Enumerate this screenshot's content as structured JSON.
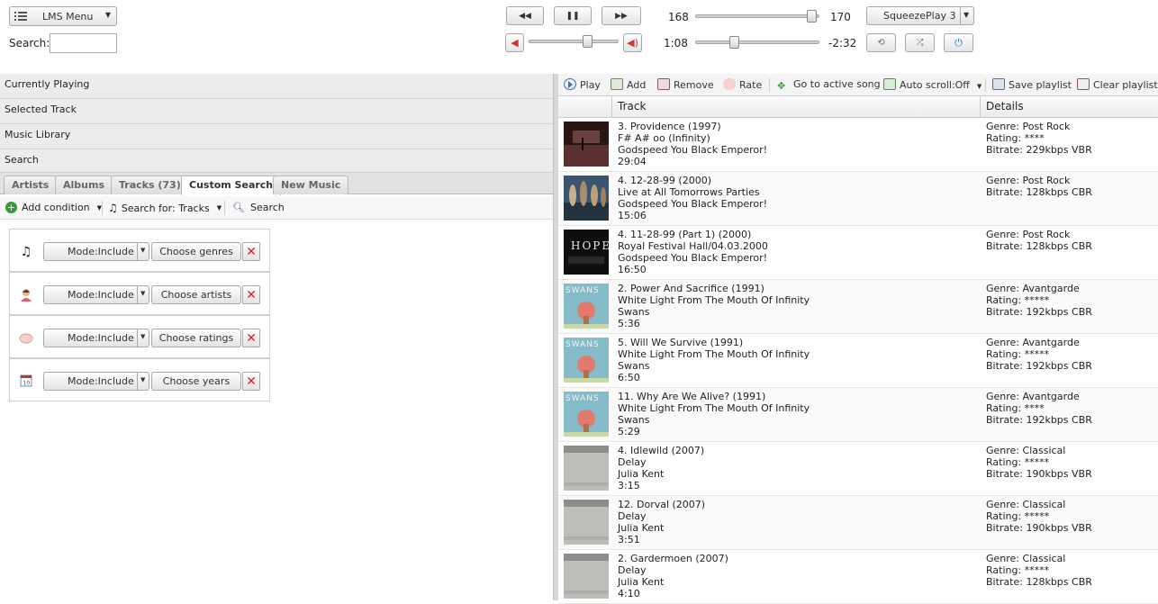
{
  "topbar": {
    "menu_label": "LMS Menu",
    "search_label": "Search:",
    "search_value": "",
    "volume_left": "168",
    "volume_right": "170",
    "volume_level": 0.98,
    "elapsed": "1:08",
    "remaining": "-2:32",
    "progress_level": 0.3,
    "balance_level": 0.67,
    "player_name": "SqueezePlay 3"
  },
  "accordion": [
    "Currently Playing",
    "Selected Track",
    "Music Library",
    "Search"
  ],
  "tabs": [
    "Artists",
    "Albums",
    "Tracks (73)",
    "Custom Search",
    "New Music"
  ],
  "active_tab": "Custom Search",
  "subtoolbar": {
    "add_condition": "Add condition",
    "search_for": "Search for: Tracks",
    "search": "Search"
  },
  "conditions": [
    {
      "icon": "music-note-icon",
      "mode": "Mode:Include",
      "choose": "Choose genres"
    },
    {
      "icon": "person-icon",
      "mode": "Mode:Include",
      "choose": "Choose artists"
    },
    {
      "icon": "hand-icon",
      "mode": "Mode:Include",
      "choose": "Choose ratings"
    },
    {
      "icon": "calendar-icon",
      "mode": "Mode:Include",
      "choose": "Choose years"
    }
  ],
  "playlist_toolbar": {
    "play": "Play",
    "add": "Add",
    "remove": "Remove",
    "rate": "Rate",
    "goto": "Go to active song",
    "autoscroll": "Auto scroll:Off",
    "save": "Save playlist",
    "clear": "Clear playlist"
  },
  "playlist_headers": {
    "track": "Track",
    "details": "Details"
  },
  "playlist": [
    {
      "line1": "3. Providence (1997)",
      "line2": "F# A# oo (Infinity)",
      "line3": "Godspeed You Black Emperor!",
      "line4": "29:04",
      "d1": "Genre: Post Rock",
      "d2": "Rating: ****",
      "d3": "Bitrate: 229kbps VBR",
      "art": "dark-red"
    },
    {
      "line1": "4. 12-28-99 (2000)",
      "line2": "Live at All Tomorrows Parties",
      "line3": "Godspeed You Black Emperor!",
      "line4": "15:06",
      "d1": "Genre: Post Rock",
      "d2": "Bitrate: 128kbps CBR",
      "d3": "",
      "art": "band"
    },
    {
      "line1": "4. 11-28-99 (Part 1) (2000)",
      "line2": "Royal Festival Hall/04.03.2000",
      "line3": "Godspeed You Black Emperor!",
      "line4": "16:50",
      "d1": "Genre: Post Rock",
      "d2": "Bitrate: 128kbps CBR",
      "d3": "",
      "art": "hope"
    },
    {
      "line1": "2. Power And Sacrifice (1991)",
      "line2": "White Light From The Mouth Of Infinity",
      "line3": "Swans",
      "line4": "5:36",
      "d1": "Genre: Avantgarde",
      "d2": "Rating: *****",
      "d3": "Bitrate: 192kbps CBR",
      "art": "swans"
    },
    {
      "line1": "5. Will We Survive (1991)",
      "line2": "White Light From The Mouth Of Infinity",
      "line3": "Swans",
      "line4": "6:50",
      "d1": "Genre: Avantgarde",
      "d2": "Rating: *****",
      "d3": "Bitrate: 192kbps CBR",
      "art": "swans"
    },
    {
      "line1": "11. Why Are We Alive? (1991)",
      "line2": "White Light From The Mouth Of Infinity",
      "line3": "Swans",
      "line4": "5:29",
      "d1": "Genre: Avantgarde",
      "d2": "Rating: ****",
      "d3": "Bitrate: 192kbps CBR",
      "art": "swans"
    },
    {
      "line1": "4. Idlewild (2007)",
      "line2": "Delay",
      "line3": "Julia Kent",
      "line4": "3:15",
      "d1": "Genre: Classical",
      "d2": "Rating: *****",
      "d3": "Bitrate: 190kbps VBR",
      "art": "grey"
    },
    {
      "line1": "12. Dorval (2007)",
      "line2": "Delay",
      "line3": "Julia Kent",
      "line4": "3:51",
      "d1": "Genre: Classical",
      "d2": "Rating: *****",
      "d3": "Bitrate: 190kbps VBR",
      "art": "grey"
    },
    {
      "line1": "2. Gardermoen (2007)",
      "line2": "Delay",
      "line3": "Julia Kent",
      "line4": "4:10",
      "d1": "Genre: Classical",
      "d2": "Rating: *****",
      "d3": "Bitrate: 128kbps CBR",
      "art": "grey"
    }
  ]
}
